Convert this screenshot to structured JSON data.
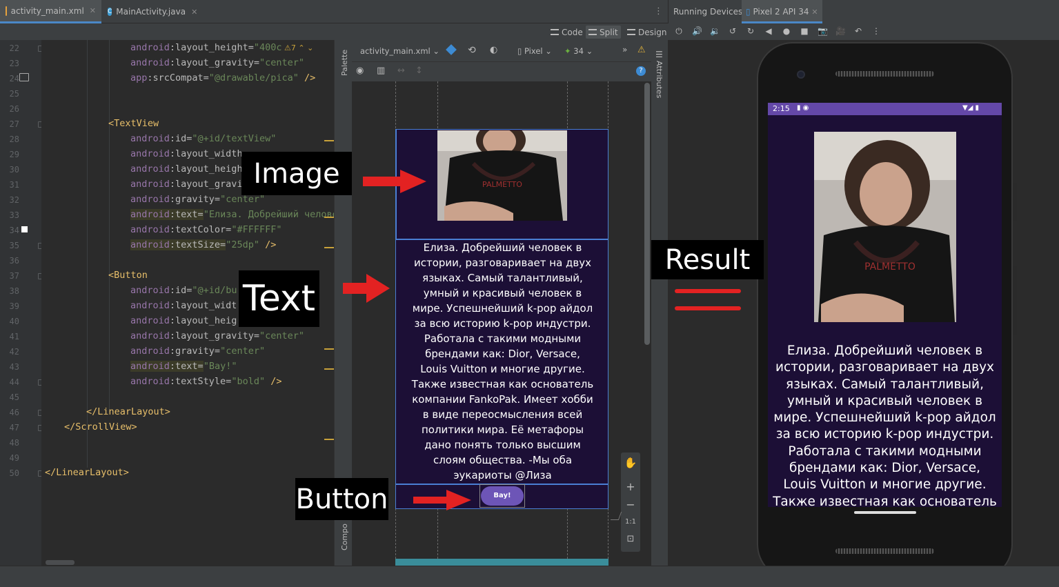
{
  "tabs": [
    {
      "label": "activity_main.xml",
      "active": true
    },
    {
      "label": "MainActivity.java",
      "active": false
    }
  ],
  "view_modes": [
    "Code",
    "Split",
    "Design"
  ],
  "running_devices": {
    "title": "Running Devices:",
    "device_tab": "Pixel 2 API 34"
  },
  "design_toolbar": {
    "file": "activity_main.xml",
    "device": "Pixel",
    "api": "34",
    "warnings": "7"
  },
  "side_panels": {
    "palette": "Palette",
    "attributes": "Attributes",
    "component_tree": "Compo"
  },
  "zoom": {
    "plus": "+",
    "minus": "−",
    "ratio": "1:1"
  },
  "code_lines": [
    {
      "n": "22",
      "indent": 4,
      "parts": [
        [
          "ns",
          "android"
        ],
        [
          "attr",
          ":layout_height="
        ],
        [
          "val",
          "\"400c"
        ]
      ]
    },
    {
      "n": "23",
      "indent": 4,
      "parts": [
        [
          "ns",
          "android"
        ],
        [
          "attr",
          ":layout_gravity="
        ],
        [
          "val",
          "\"center\""
        ]
      ]
    },
    {
      "n": "24",
      "indent": 4,
      "parts": [
        [
          "ns",
          "app"
        ],
        [
          "attr",
          ":srcCompat="
        ],
        [
          "val",
          "\"@drawable/pica\""
        ],
        [
          "t",
          " />"
        ]
      ]
    },
    {
      "n": "25",
      "indent": 0,
      "parts": []
    },
    {
      "n": "26",
      "indent": 0,
      "parts": []
    },
    {
      "n": "27",
      "indent": 3,
      "parts": [
        [
          "t",
          "<TextView"
        ]
      ]
    },
    {
      "n": "28",
      "indent": 4,
      "parts": [
        [
          "ns",
          "android"
        ],
        [
          "attr",
          ":id="
        ],
        [
          "val",
          "\"@+id/textView\""
        ]
      ]
    },
    {
      "n": "29",
      "indent": 4,
      "parts": [
        [
          "ns",
          "android"
        ],
        [
          "attr",
          ":layout_width"
        ]
      ]
    },
    {
      "n": "30",
      "indent": 4,
      "parts": [
        [
          "ns",
          "android"
        ],
        [
          "attr",
          ":layout_heigh"
        ]
      ]
    },
    {
      "n": "31",
      "indent": 4,
      "parts": [
        [
          "ns",
          "android"
        ],
        [
          "attr",
          ":layout_gravi"
        ]
      ]
    },
    {
      "n": "32",
      "indent": 4,
      "parts": [
        [
          "ns",
          "android"
        ],
        [
          "attr",
          ":gravity="
        ],
        [
          "val",
          "\"center\""
        ]
      ]
    },
    {
      "n": "33",
      "indent": 4,
      "hl": true,
      "parts": [
        [
          "ns",
          "android"
        ],
        [
          "attr",
          ":text="
        ],
        [
          "val",
          "\"Елиза. Добрейший челове"
        ]
      ]
    },
    {
      "n": "34",
      "indent": 4,
      "parts": [
        [
          "ns",
          "android"
        ],
        [
          "attr",
          ":textColor="
        ],
        [
          "val",
          "\"#FFFFFF\""
        ]
      ]
    },
    {
      "n": "35",
      "indent": 4,
      "hl": true,
      "parts": [
        [
          "ns",
          "android"
        ],
        [
          "attr",
          ":textSize="
        ],
        [
          "val",
          "\"25dp\""
        ],
        [
          "t",
          " />"
        ]
      ]
    },
    {
      "n": "36",
      "indent": 0,
      "parts": []
    },
    {
      "n": "37",
      "indent": 3,
      "parts": [
        [
          "t",
          "<Button"
        ]
      ]
    },
    {
      "n": "38",
      "indent": 4,
      "parts": [
        [
          "ns",
          "android"
        ],
        [
          "attr",
          ":id="
        ],
        [
          "val",
          "\"@+id/bu"
        ]
      ]
    },
    {
      "n": "39",
      "indent": 4,
      "parts": [
        [
          "ns",
          "android"
        ],
        [
          "attr",
          ":layout_widt"
        ]
      ]
    },
    {
      "n": "40",
      "indent": 4,
      "parts": [
        [
          "ns",
          "android"
        ],
        [
          "attr",
          ":layout_heig"
        ]
      ]
    },
    {
      "n": "41",
      "indent": 4,
      "parts": [
        [
          "ns",
          "android"
        ],
        [
          "attr",
          ":layout_gravity="
        ],
        [
          "val",
          "\"center\""
        ]
      ]
    },
    {
      "n": "42",
      "indent": 4,
      "parts": [
        [
          "ns",
          "android"
        ],
        [
          "attr",
          ":gravity="
        ],
        [
          "val",
          "\"center\""
        ]
      ]
    },
    {
      "n": "43",
      "indent": 4,
      "hl": true,
      "parts": [
        [
          "ns",
          "android"
        ],
        [
          "attr",
          ":text="
        ],
        [
          "val",
          "\"Bay!\""
        ]
      ]
    },
    {
      "n": "44",
      "indent": 4,
      "parts": [
        [
          "ns",
          "android"
        ],
        [
          "attr",
          ":textStyle="
        ],
        [
          "val",
          "\"bold\""
        ],
        [
          "t",
          " />"
        ]
      ]
    },
    {
      "n": "45",
      "indent": 0,
      "parts": []
    },
    {
      "n": "46",
      "indent": 2,
      "parts": [
        [
          "t",
          "</LinearLayout>"
        ]
      ]
    },
    {
      "n": "47",
      "indent": 1,
      "parts": [
        [
          "t",
          "</ScrollView>"
        ]
      ]
    },
    {
      "n": "48",
      "indent": 0,
      "parts": []
    },
    {
      "n": "49",
      "indent": 0,
      "parts": []
    },
    {
      "n": "50",
      "indent": 0,
      "parts": [
        [
          "t",
          "</LinearLayout>"
        ]
      ]
    }
  ],
  "preview": {
    "text_lines": [
      "Елиза. Добрейший человек в",
      "истории, разговаривает на двух",
      "языках. Самый талантливый,",
      "умный и красивый человек в",
      "мире. Успешнейший k-pop айдол",
      "за всю историю k-pop индустри.",
      "Работала с такими модными",
      "брендами как: Dior, Versace,",
      "Louis Vuitton и многие другие.",
      "Также известная как основатель",
      "компании FankoPak. Имеет хобби",
      "в виде переосмысления всей",
      "политики мира. Её метафоры",
      "дано понять только высшим",
      "слоям общества. -Мы оба",
      "эукариоты @Лиза"
    ],
    "button_label": "Bay!"
  },
  "device": {
    "time": "2:15",
    "text_lines": [
      "Елиза. Добрейший человек в",
      "истории, разговаривает на двух",
      "языках. Самый талантливый,",
      "умный и красивый человек в",
      "мире. Успешнейший k-pop айдол",
      "за всю историю k-pop индустри.",
      "Работала с такими модными",
      "брендами как: Dior, Versace,",
      "Louis Vuitton и многие другие.",
      "Также известная как основатель"
    ]
  },
  "annotations": {
    "image": "Image",
    "text": "Text",
    "button": "Button",
    "result": "Result"
  },
  "colors": {
    "arrow": "#e32222",
    "app_bg": "#1c0f36",
    "status_bar": "#6448a8",
    "button": "#6d55b7"
  }
}
